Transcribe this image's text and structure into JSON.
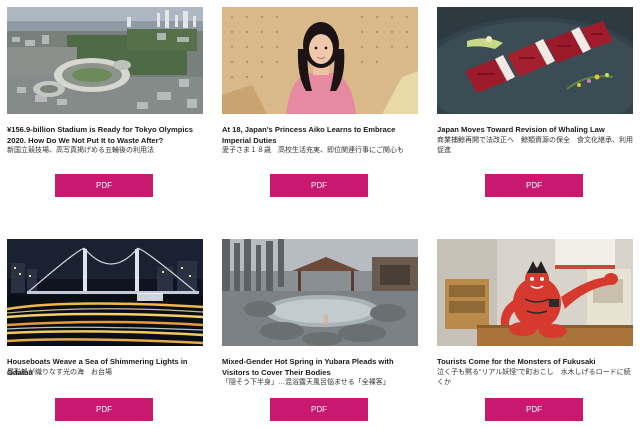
{
  "colors": {
    "button_bg": "#c8186f",
    "button_text": "#ffffff",
    "title_text": "#1a1a1a",
    "sub_text": "#333333"
  },
  "articles": [
    {
      "title": "¥156.9-billion Stadium is Ready for Tokyo Olympics 2020. How Do We Not Put It to Waste After?",
      "subtitle": "新国立競技場、高写真掲げめる五輪後の利用法",
      "pdf_label": "PDF",
      "image": "aerial-stadium-photo"
    },
    {
      "title": "At 18, Japan's Princess Aiko Learns to Embrace Imperial Duties",
      "subtitle": "愛子さま１８歳　高校生活充実、即位関連行事にご関心も",
      "pdf_label": "PDF",
      "image": "princess-portrait-photo"
    },
    {
      "title": "Japan Moves Toward Revision of Whaling Law",
      "subtitle": "商業捕鯨再開で法改正へ　鯨類資源の保全　食文化継承、利用促進",
      "pdf_label": "PDF",
      "image": "whale-meat-dish-photo"
    },
    {
      "title": "Houseboats Weave a Sea of Shimmering Lights in Odaiba",
      "subtitle": "屋形船が織りなす光の海　お台場",
      "pdf_label": "PDF",
      "image": "rainbow-bridge-night-photo"
    },
    {
      "title": "Mixed-Gender Hot Spring in Yubara Pleads with Visitors to Cover Their Bodies",
      "subtitle": "「隠そう下半身」…混浴露天風呂悩ませる「全裸客」",
      "pdf_label": "PDF",
      "image": "hot-spring-photo"
    },
    {
      "title": "Tourists Come for the Monsters of Fukusaki",
      "subtitle": "泣く子も黙る“リアル妖怪”で町おこし　水木しげるロードに続くか",
      "pdf_label": "PDF",
      "image": "red-monster-statue-photo"
    }
  ]
}
